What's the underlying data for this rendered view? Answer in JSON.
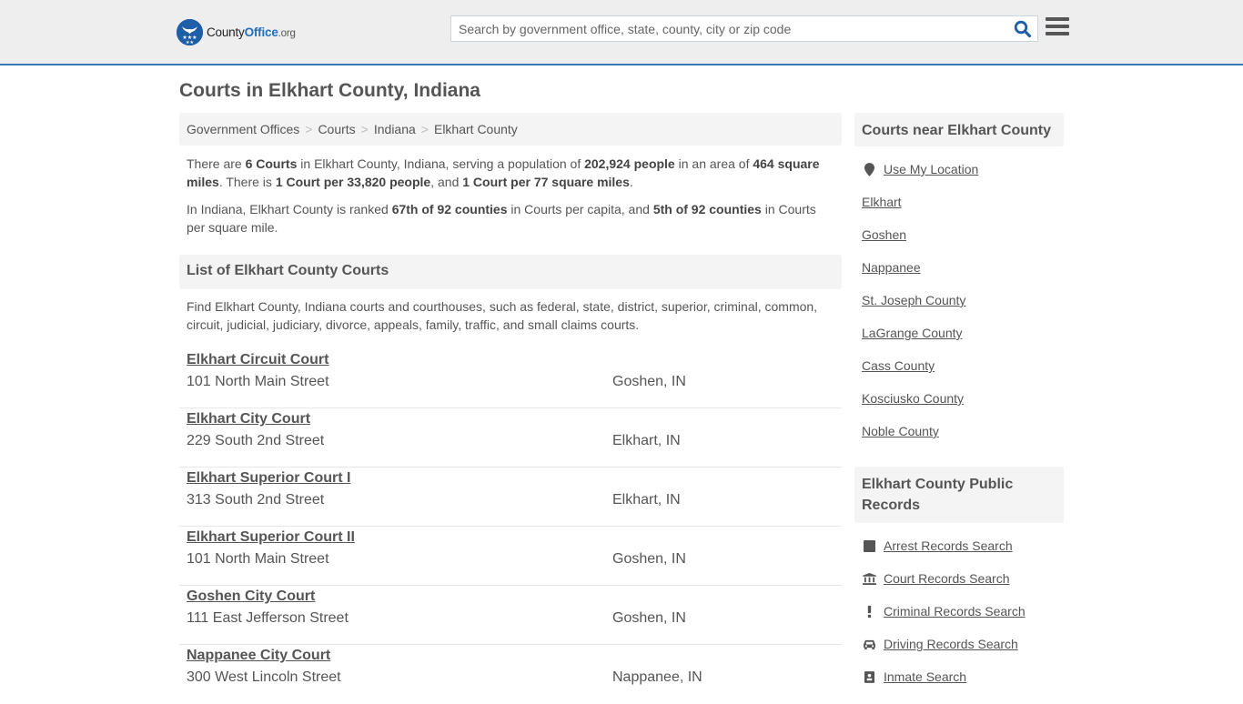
{
  "header": {
    "logo": {
      "text_main": "County",
      "text_accent": "Office",
      "text_suffix": ".org",
      "icon": "eagle-stars-badge-icon"
    },
    "search": {
      "placeholder": "Search by government office, state, county, city or zip code",
      "value": "",
      "icon": "search-icon"
    },
    "menu_icon": "hamburger-menu-icon"
  },
  "colors": {
    "brand_blue": "#1f5fa8",
    "header_border": "#337ab7",
    "text": "#555555",
    "panel_bg": "#f4f4f4"
  },
  "page": {
    "title": "Courts in Elkhart County, Indiana"
  },
  "breadcrumb": [
    "Government Offices",
    "Courts",
    "Indiana",
    "Elkhart County"
  ],
  "intro": {
    "p1": [
      {
        "t": "There are "
      },
      {
        "b": "6 Courts"
      },
      {
        "t": " in Elkhart County, Indiana, serving a population of "
      },
      {
        "b": "202,924 people"
      },
      {
        "t": " in an area of "
      },
      {
        "b": "464 square miles"
      },
      {
        "t": ". There is "
      },
      {
        "b": "1 Court per 33,820 people"
      },
      {
        "t": ", and "
      },
      {
        "b": "1 Court per 77 square miles"
      },
      {
        "t": "."
      }
    ],
    "p2": [
      {
        "t": "In Indiana, Elkhart County is ranked "
      },
      {
        "b": "67th of 92 counties"
      },
      {
        "t": " in Courts per capita, and "
      },
      {
        "b": "5th of 92 counties"
      },
      {
        "t": " in Courts per square mile."
      }
    ]
  },
  "list": {
    "heading": "List of Elkhart County Courts",
    "description": "Find Elkhart County, Indiana courts and courthouses, such as federal, state, district, superior, criminal, common, circuit, judicial, judiciary, divorce, appeals, family, traffic, and small claims courts.",
    "courts": [
      {
        "name": "Elkhart Circuit Court",
        "address": "101 North Main Street",
        "city": "Goshen, IN"
      },
      {
        "name": "Elkhart City Court",
        "address": "229 South 2nd Street",
        "city": "Elkhart, IN"
      },
      {
        "name": "Elkhart Superior Court I",
        "address": "313 South 2nd Street",
        "city": "Elkhart, IN"
      },
      {
        "name": "Elkhart Superior Court II",
        "address": "101 North Main Street",
        "city": "Goshen, IN"
      },
      {
        "name": "Goshen City Court",
        "address": "111 East Jefferson Street",
        "city": "Goshen, IN"
      },
      {
        "name": "Nappanee City Court",
        "address": "300 West Lincoln Street",
        "city": "Nappanee, IN"
      }
    ]
  },
  "sidebar": {
    "nearby": {
      "heading": "Courts near Elkhart County",
      "use_location": {
        "label": "Use My Location",
        "icon": "map-marker-icon"
      },
      "links": [
        "Elkhart",
        "Goshen",
        "Nappanee",
        "St. Joseph County",
        "LaGrange County",
        "Cass County",
        "Kosciusko County",
        "Noble County"
      ]
    },
    "records": {
      "heading": "Elkhart County Public Records",
      "links": [
        {
          "label": "Arrest Records Search",
          "icon": "square-icon"
        },
        {
          "label": "Court Records Search",
          "icon": "courthouse-icon"
        },
        {
          "label": "Criminal Records Search",
          "icon": "exclamation-icon"
        },
        {
          "label": "Driving Records Search",
          "icon": "car-icon"
        },
        {
          "label": "Inmate Search",
          "icon": "id-badge-icon"
        }
      ]
    }
  }
}
